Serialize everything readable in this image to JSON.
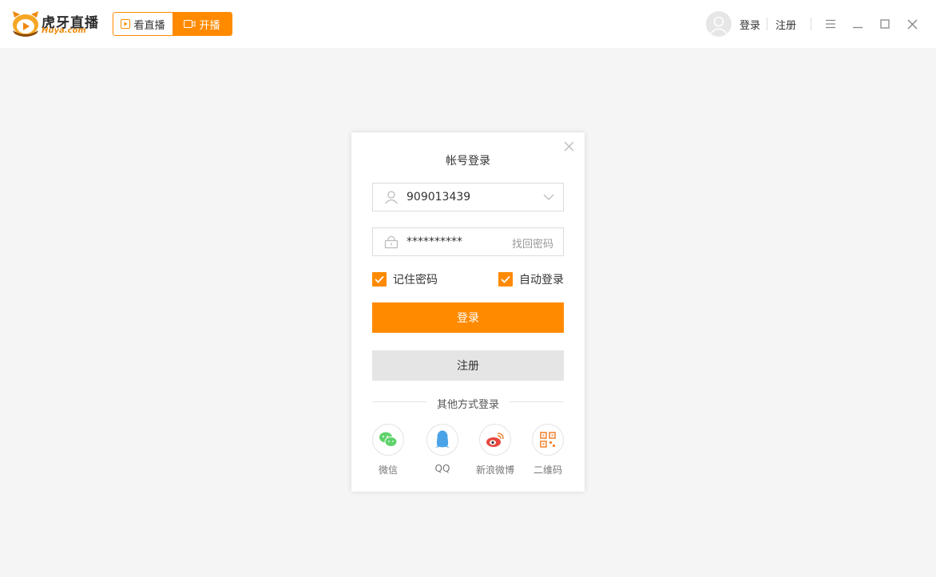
{
  "header": {
    "logo": {
      "main": "虎牙直播",
      "sub": "Huya.com"
    },
    "mode_tabs": [
      {
        "label": "看直播",
        "icon": "play-icon"
      },
      {
        "label": "开播",
        "icon": "video-camera-icon"
      }
    ],
    "login_link": "登录",
    "register_link": "注册",
    "window_controls": [
      "menu-icon",
      "minimize-icon",
      "maximize-icon",
      "close-icon"
    ]
  },
  "dialog": {
    "title": "帐号登录",
    "username": {
      "value": "909013439"
    },
    "password": {
      "value": "**********",
      "forgot_label": "找回密码"
    },
    "remember_password": {
      "label": "记住密码",
      "checked": true
    },
    "auto_login": {
      "label": "自动登录",
      "checked": true
    },
    "login_button": "登录",
    "register_button": "注册",
    "other_methods_label": "其他方式登录",
    "social": [
      {
        "label": "微信",
        "icon": "wechat-icon"
      },
      {
        "label": "QQ",
        "icon": "qq-icon"
      },
      {
        "label": "新浪微博",
        "icon": "weibo-icon"
      },
      {
        "label": "二维码",
        "icon": "qr-code-icon"
      }
    ]
  },
  "colors": {
    "accent": "#ff8a00",
    "background": "#f5f5f5",
    "wechat": "#5fd26b",
    "qq": "#4aa3e6",
    "weibo": "#e6473f",
    "qr": "#f0883a"
  }
}
